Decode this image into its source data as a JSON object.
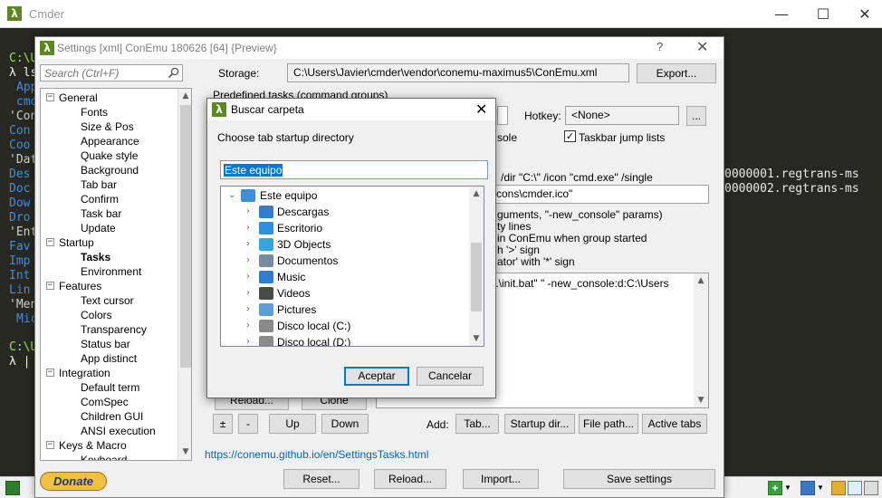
{
  "cmder": {
    "title": "Cmder",
    "controls": {
      "minimize": "—",
      "maximize": "☐",
      "close": "✕"
    }
  },
  "console": {
    "prompt1": "C:\\U",
    "cmd_line": "λ ls",
    "lines": [
      "App",
      "cmd",
      "'Con",
      "Con",
      "Coo",
      "'Dat",
      "Des",
      "Doc",
      "Dow",
      "Dro",
      "'Ent",
      "Fav",
      "Imp",
      "Int",
      "Lin",
      "'Men",
      "Mic"
    ],
    "prompt2": "C:\\U",
    "prompt_lambda": "λ |",
    "right_lines": [
      "0000001.regtrans-ms",
      "0000002.regtrans-ms"
    ]
  },
  "settings": {
    "title": "Settings [xml] ConEmu 180626 [64] {Preview}",
    "help": "?",
    "close": "✕",
    "search_placeholder": "Search (Ctrl+F)",
    "storage_label": "Storage:",
    "storage_path": "C:\\Users\\Javier\\cmder\\vendor\\conemu-maximus5\\ConEmu.xml",
    "export_btn": "Export...",
    "predefined_tasks": "Predefined tasks (command groups)",
    "hotkey_label": "Hotkey:",
    "hotkey_value": "<None>",
    "ellipsis_btn": "...",
    "console_fragment": "sole",
    "taskbar_jump": "Taskbar jump lists",
    "cmd_args": "/dir \"C:\\\" /icon \"cmd.exe\" /single",
    "icon_path": "\\icons\\cmder.ico\"",
    "info_lines": [
      "guments, \"-new_console\" params)",
      "ty lines",
      "in ConEmu when group started",
      "h '>' sign",
      "ator' with '*' sign"
    ],
    "task_command": "..\\init.bat\" \" -new_console:d:C:\\Users",
    "reload_btn_partial": "Reload...",
    "clone_btn": "Clone",
    "plus_btn": "±",
    "minus_btn": "-",
    "up_btn": "Up",
    "down_btn": "Down",
    "add_label": "Add:",
    "tab_btn": "Tab...",
    "startup_dir_btn": "Startup dir...",
    "file_path_btn": "File path...",
    "active_tabs_btn": "Active tabs",
    "help_link": "https://conemu.github.io/en/SettingsTasks.html",
    "donate": "Donate",
    "reset_btn": "Reset...",
    "reload_btn": "Reload...",
    "import_btn": "Import...",
    "save_btn": "Save settings"
  },
  "tree": {
    "items": [
      {
        "label": "General",
        "level": 0,
        "expander": "−"
      },
      {
        "label": "Fonts",
        "level": 1
      },
      {
        "label": "Size & Pos",
        "level": 1
      },
      {
        "label": "Appearance",
        "level": 1
      },
      {
        "label": "Quake style",
        "level": 1
      },
      {
        "label": "Background",
        "level": 1
      },
      {
        "label": "Tab bar",
        "level": 1
      },
      {
        "label": "Confirm",
        "level": 1
      },
      {
        "label": "Task bar",
        "level": 1
      },
      {
        "label": "Update",
        "level": 1
      },
      {
        "label": "Startup",
        "level": 0,
        "expander": "−"
      },
      {
        "label": "Tasks",
        "level": 1,
        "selected": true
      },
      {
        "label": "Environment",
        "level": 1
      },
      {
        "label": "Features",
        "level": 0,
        "expander": "−"
      },
      {
        "label": "Text cursor",
        "level": 1
      },
      {
        "label": "Colors",
        "level": 1
      },
      {
        "label": "Transparency",
        "level": 1
      },
      {
        "label": "Status bar",
        "level": 1
      },
      {
        "label": "App distinct",
        "level": 1
      },
      {
        "label": "Integration",
        "level": 0,
        "expander": "−"
      },
      {
        "label": "Default term",
        "level": 1
      },
      {
        "label": "ComSpec",
        "level": 1
      },
      {
        "label": "Children GUI",
        "level": 1
      },
      {
        "label": "ANSI execution",
        "level": 1
      },
      {
        "label": "Keys & Macro",
        "level": 0,
        "expander": "−"
      },
      {
        "label": "Keyboard",
        "level": 1
      }
    ]
  },
  "dialog": {
    "title": "Buscar carpeta",
    "close": "✕",
    "description": "Choose tab startup directory",
    "folder_value": "Este equipo",
    "tree": [
      {
        "label": "Este equipo",
        "expanded": true,
        "level": 0,
        "icon": "computer-icon",
        "color": "#3c8fd8"
      },
      {
        "label": "Descargas",
        "level": 1,
        "icon": "downloads-icon",
        "color": "#2f7fd0"
      },
      {
        "label": "Escritorio",
        "level": 1,
        "icon": "desktop-icon",
        "color": "#2d8fe0"
      },
      {
        "label": "3D Objects",
        "level": 1,
        "icon": "3d-objects-icon",
        "color": "#36a5d8"
      },
      {
        "label": "Documentos",
        "level": 1,
        "icon": "documents-icon",
        "color": "#7a8aa0"
      },
      {
        "label": "Music",
        "level": 1,
        "icon": "music-icon",
        "color": "#2a7fd4"
      },
      {
        "label": "Videos",
        "level": 1,
        "icon": "videos-icon",
        "color": "#4a4a4a"
      },
      {
        "label": "Pictures",
        "level": 1,
        "icon": "pictures-icon",
        "color": "#5aa0d8"
      },
      {
        "label": "Disco local (C:)",
        "level": 1,
        "icon": "drive-c-icon",
        "color": "#8a8a8a"
      },
      {
        "label": "Disco local (D:)",
        "level": 1,
        "icon": "drive-d-icon",
        "color": "#8a8a8a"
      }
    ],
    "accept_btn": "Aceptar",
    "cancel_btn": "Cancelar"
  },
  "colors": {
    "accent": "#0078d7",
    "console_bg": "#272822",
    "link": "#0066cc"
  }
}
